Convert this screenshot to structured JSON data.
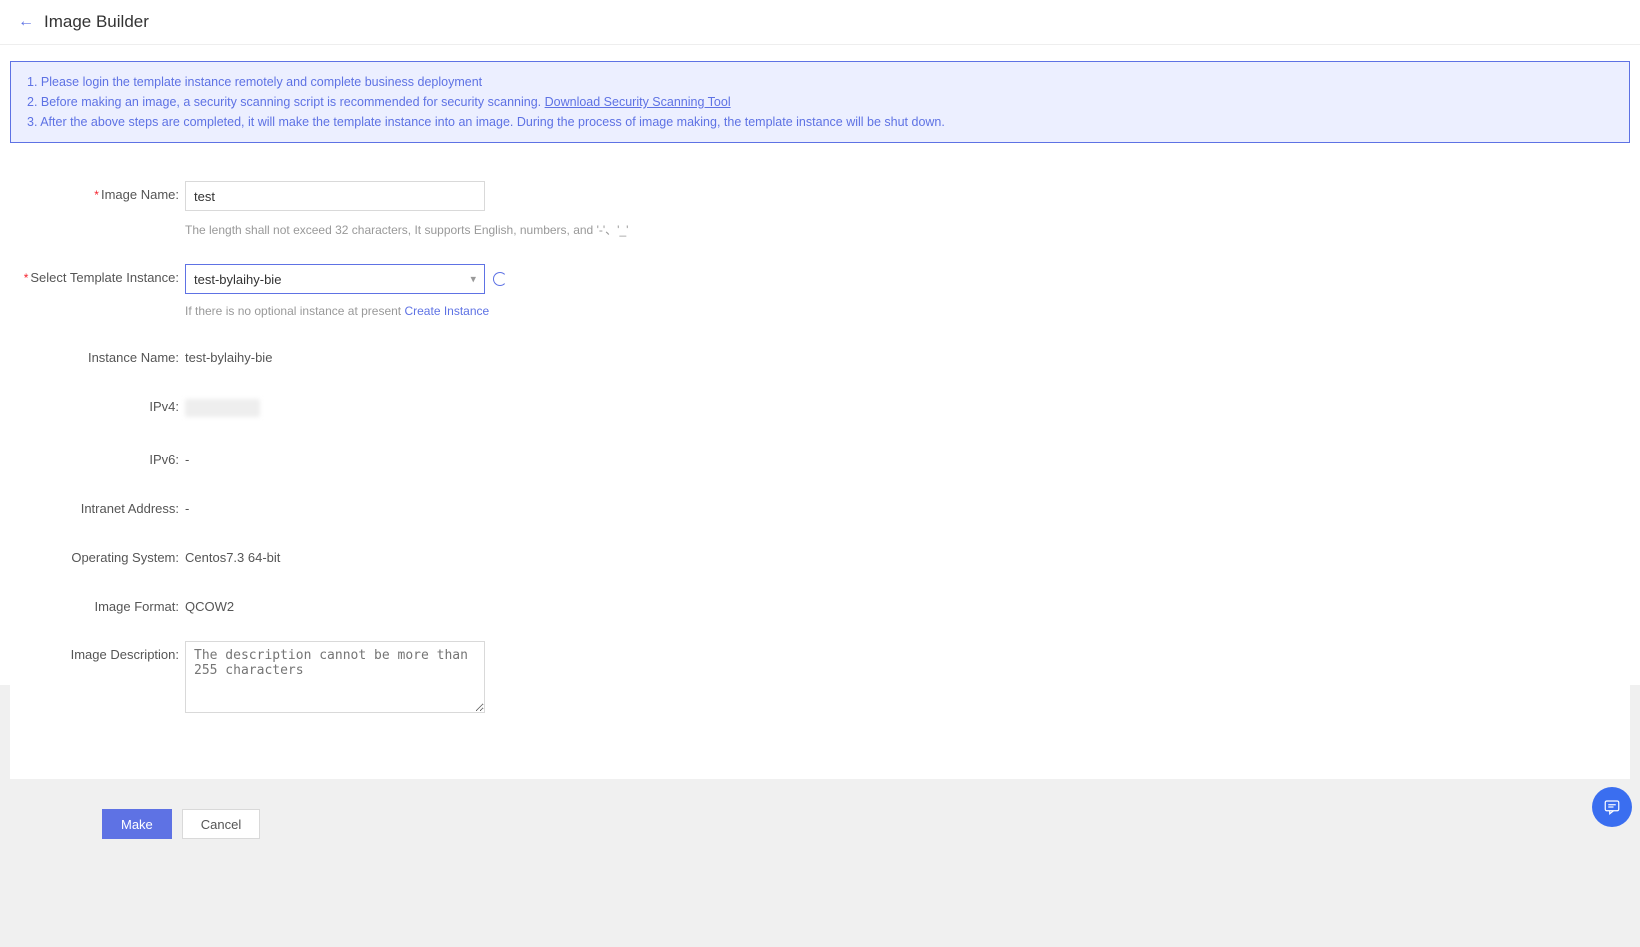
{
  "header": {
    "title": "Image Builder"
  },
  "notice": {
    "line1": "1. Please login the template instance remotely and complete business deployment",
    "line2_prefix": "2. Before making an image, a security scanning script is recommended for security scanning. ",
    "line2_link": "Download Security Scanning Tool",
    "line3": "3. After the above steps are completed, it will make the template instance into an image. During the process of image making, the template instance will be shut down."
  },
  "form": {
    "image_name": {
      "label": "Image Name:",
      "value": "test",
      "hint": "The length shall not exceed 32 characters, It supports English, numbers, and '-'、'_'"
    },
    "select_template": {
      "label": "Select Template Instance:",
      "selected": "test-bylaihy-bie",
      "hint_prefix": "If there is no optional instance at present ",
      "hint_link": "Create Instance"
    },
    "instance_name": {
      "label": "Instance Name:",
      "value": "test-bylaihy-bie"
    },
    "ipv4": {
      "label": "IPv4:",
      "value": ""
    },
    "ipv6": {
      "label": "IPv6:",
      "value": "-"
    },
    "intranet": {
      "label": "Intranet Address:",
      "value": "-"
    },
    "os": {
      "label": "Operating System:",
      "value": "Centos7.3 64-bit"
    },
    "format": {
      "label": "Image Format:",
      "value": "QCOW2"
    },
    "description": {
      "label": "Image Description:",
      "placeholder": "The description cannot be more than 255 characters"
    }
  },
  "buttons": {
    "make": "Make",
    "cancel": "Cancel"
  }
}
